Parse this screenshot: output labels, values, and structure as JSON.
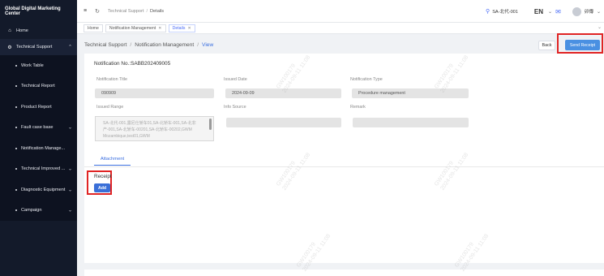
{
  "sidebar": {
    "brand": "Global Digital Marketing Center",
    "home": "Home",
    "technical_support": "Technical Support",
    "items": [
      {
        "label": "Work Table",
        "has_chevron": false
      },
      {
        "label": "Technical Report",
        "has_chevron": false
      },
      {
        "label": "Product Report",
        "has_chevron": false
      },
      {
        "label": "Fault case base",
        "has_chevron": true
      },
      {
        "label": "Notification Manage...",
        "has_chevron": false
      },
      {
        "label": "Technical Improved ...",
        "has_chevron": true
      },
      {
        "label": "Diagnostic Equipment",
        "has_chevron": true
      },
      {
        "label": "Campaign",
        "has_chevron": true
      }
    ]
  },
  "header": {
    "breadcrumb": [
      "Technical Support",
      "Details"
    ],
    "user": "SA-北代-001",
    "language": "EN",
    "avatar_name": "卯傳"
  },
  "tabs": [
    {
      "label": "Home",
      "closable": false,
      "active": false
    },
    {
      "label": "Notification Management",
      "closable": true,
      "active": false
    },
    {
      "label": "Details",
      "closable": true,
      "active": true
    }
  ],
  "page": {
    "breadcrumb": {
      "a": "Technical Support",
      "b": "Notification Management",
      "c": "View"
    },
    "back_label": "Back",
    "send_receipt_label": "Send Receipt",
    "notification_no": "Notification No.:SABB202409005"
  },
  "fields": {
    "title_label": "Notification Title",
    "title_value": "090909",
    "issued_date_label": "Issued Date",
    "issued_date_value": "2024-09-09",
    "type_label": "Notification Type",
    "type_value": "Procedure management",
    "range_label": "Issued Range",
    "range_value": "SA-北代-001,露尼仕轿车01,SA-北轿车-001,SA-北非产-001,SA-北轿车-00201,SA-北轿车-00202,GWM Mozambique,test01,GWM",
    "info_source_label": "Info Source",
    "info_source_value": "",
    "remark_label": "Remark",
    "remark_value": ""
  },
  "attachment_tab": "Attachment",
  "receipt": {
    "label": "Receipt",
    "add_label": "Add"
  },
  "watermark": "GW100179\n2024-09-11 11:08",
  "colors": {
    "sidebar_bg": "#131a2a",
    "primary": "#3a6fd8",
    "highlight_outline": "#e02424"
  }
}
